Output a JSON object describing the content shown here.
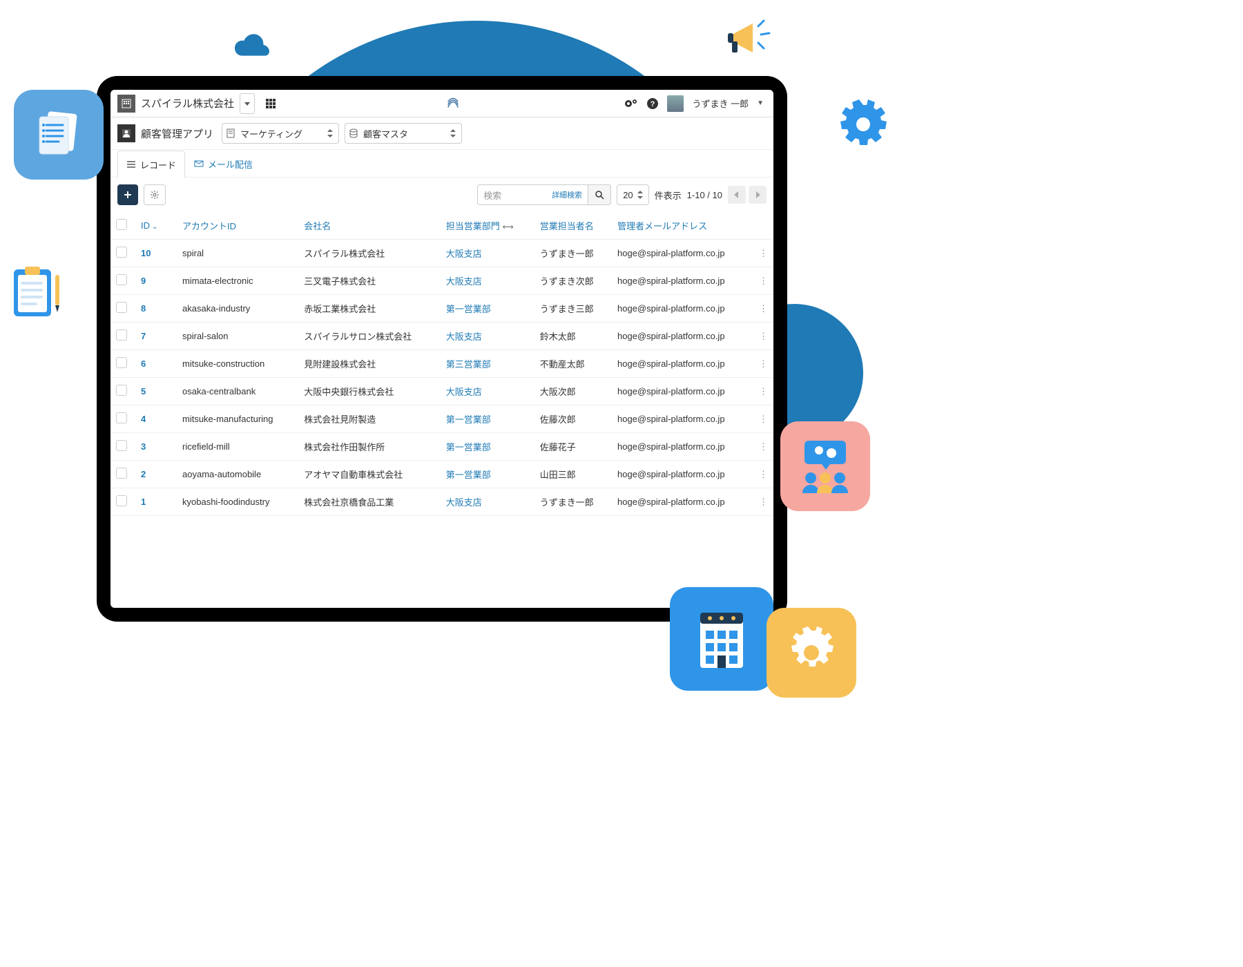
{
  "topbar": {
    "org_name": "スパイラル株式会社",
    "username": "うずまき 一郎"
  },
  "secondbar": {
    "app_name": "顧客管理アプリ",
    "select1": "マーケティング",
    "select2": "顧客マスタ"
  },
  "tabs": {
    "records": "レコード",
    "mail": "メール配信"
  },
  "toolbar": {
    "search_placeholder": "検索",
    "advanced_search": "詳細検索",
    "page_size": "20",
    "page_label": "件表示",
    "page_range": "1-10 / 10"
  },
  "columns": {
    "id": "ID",
    "account_id": "アカウントID",
    "company": "会社名",
    "department": "担当営業部門",
    "sales_rep": "営業担当者名",
    "admin_email": "管理者メールアドレス"
  },
  "rows": [
    {
      "id": "10",
      "account": "spiral",
      "company": "スパイラル株式会社",
      "dept": "大阪支店",
      "rep": "うずまき一郎",
      "email": "hoge@spiral-platform.co.jp"
    },
    {
      "id": "9",
      "account": "mimata-electronic",
      "company": "三叉電子株式会社",
      "dept": "大阪支店",
      "rep": "うずまき次郎",
      "email": "hoge@spiral-platform.co.jp"
    },
    {
      "id": "8",
      "account": "akasaka-industry",
      "company": "赤坂工業株式会社",
      "dept": "第一営業部",
      "rep": "うずまき三郎",
      "email": "hoge@spiral-platform.co.jp"
    },
    {
      "id": "7",
      "account": "spiral-salon",
      "company": "スパイラルサロン株式会社",
      "dept": "大阪支店",
      "rep": "鈴木太郎",
      "email": "hoge@spiral-platform.co.jp"
    },
    {
      "id": "6",
      "account": "mitsuke-construction",
      "company": "見附建設株式会社",
      "dept": "第三営業部",
      "rep": "不動産太郎",
      "email": "hoge@spiral-platform.co.jp"
    },
    {
      "id": "5",
      "account": "osaka-centralbank",
      "company": "大阪中央銀行株式会社",
      "dept": "大阪支店",
      "rep": "大阪次郎",
      "email": "hoge@spiral-platform.co.jp"
    },
    {
      "id": "4",
      "account": "mitsuke-manufacturing",
      "company": "株式会社見附製造",
      "dept": "第一営業部",
      "rep": "佐藤次郎",
      "email": "hoge@spiral-platform.co.jp"
    },
    {
      "id": "3",
      "account": "ricefield-mill",
      "company": "株式会社作田製作所",
      "dept": "第一営業部",
      "rep": "佐藤花子",
      "email": "hoge@spiral-platform.co.jp"
    },
    {
      "id": "2",
      "account": "aoyama-automobile",
      "company": "アオヤマ自動車株式会社",
      "dept": "第一営業部",
      "rep": "山田三郎",
      "email": "hoge@spiral-platform.co.jp"
    },
    {
      "id": "1",
      "account": "kyobashi-foodindustry",
      "company": "株式会社京橋食品工業",
      "dept": "大阪支店",
      "rep": "うずまき一郎",
      "email": "hoge@spiral-platform.co.jp"
    }
  ]
}
